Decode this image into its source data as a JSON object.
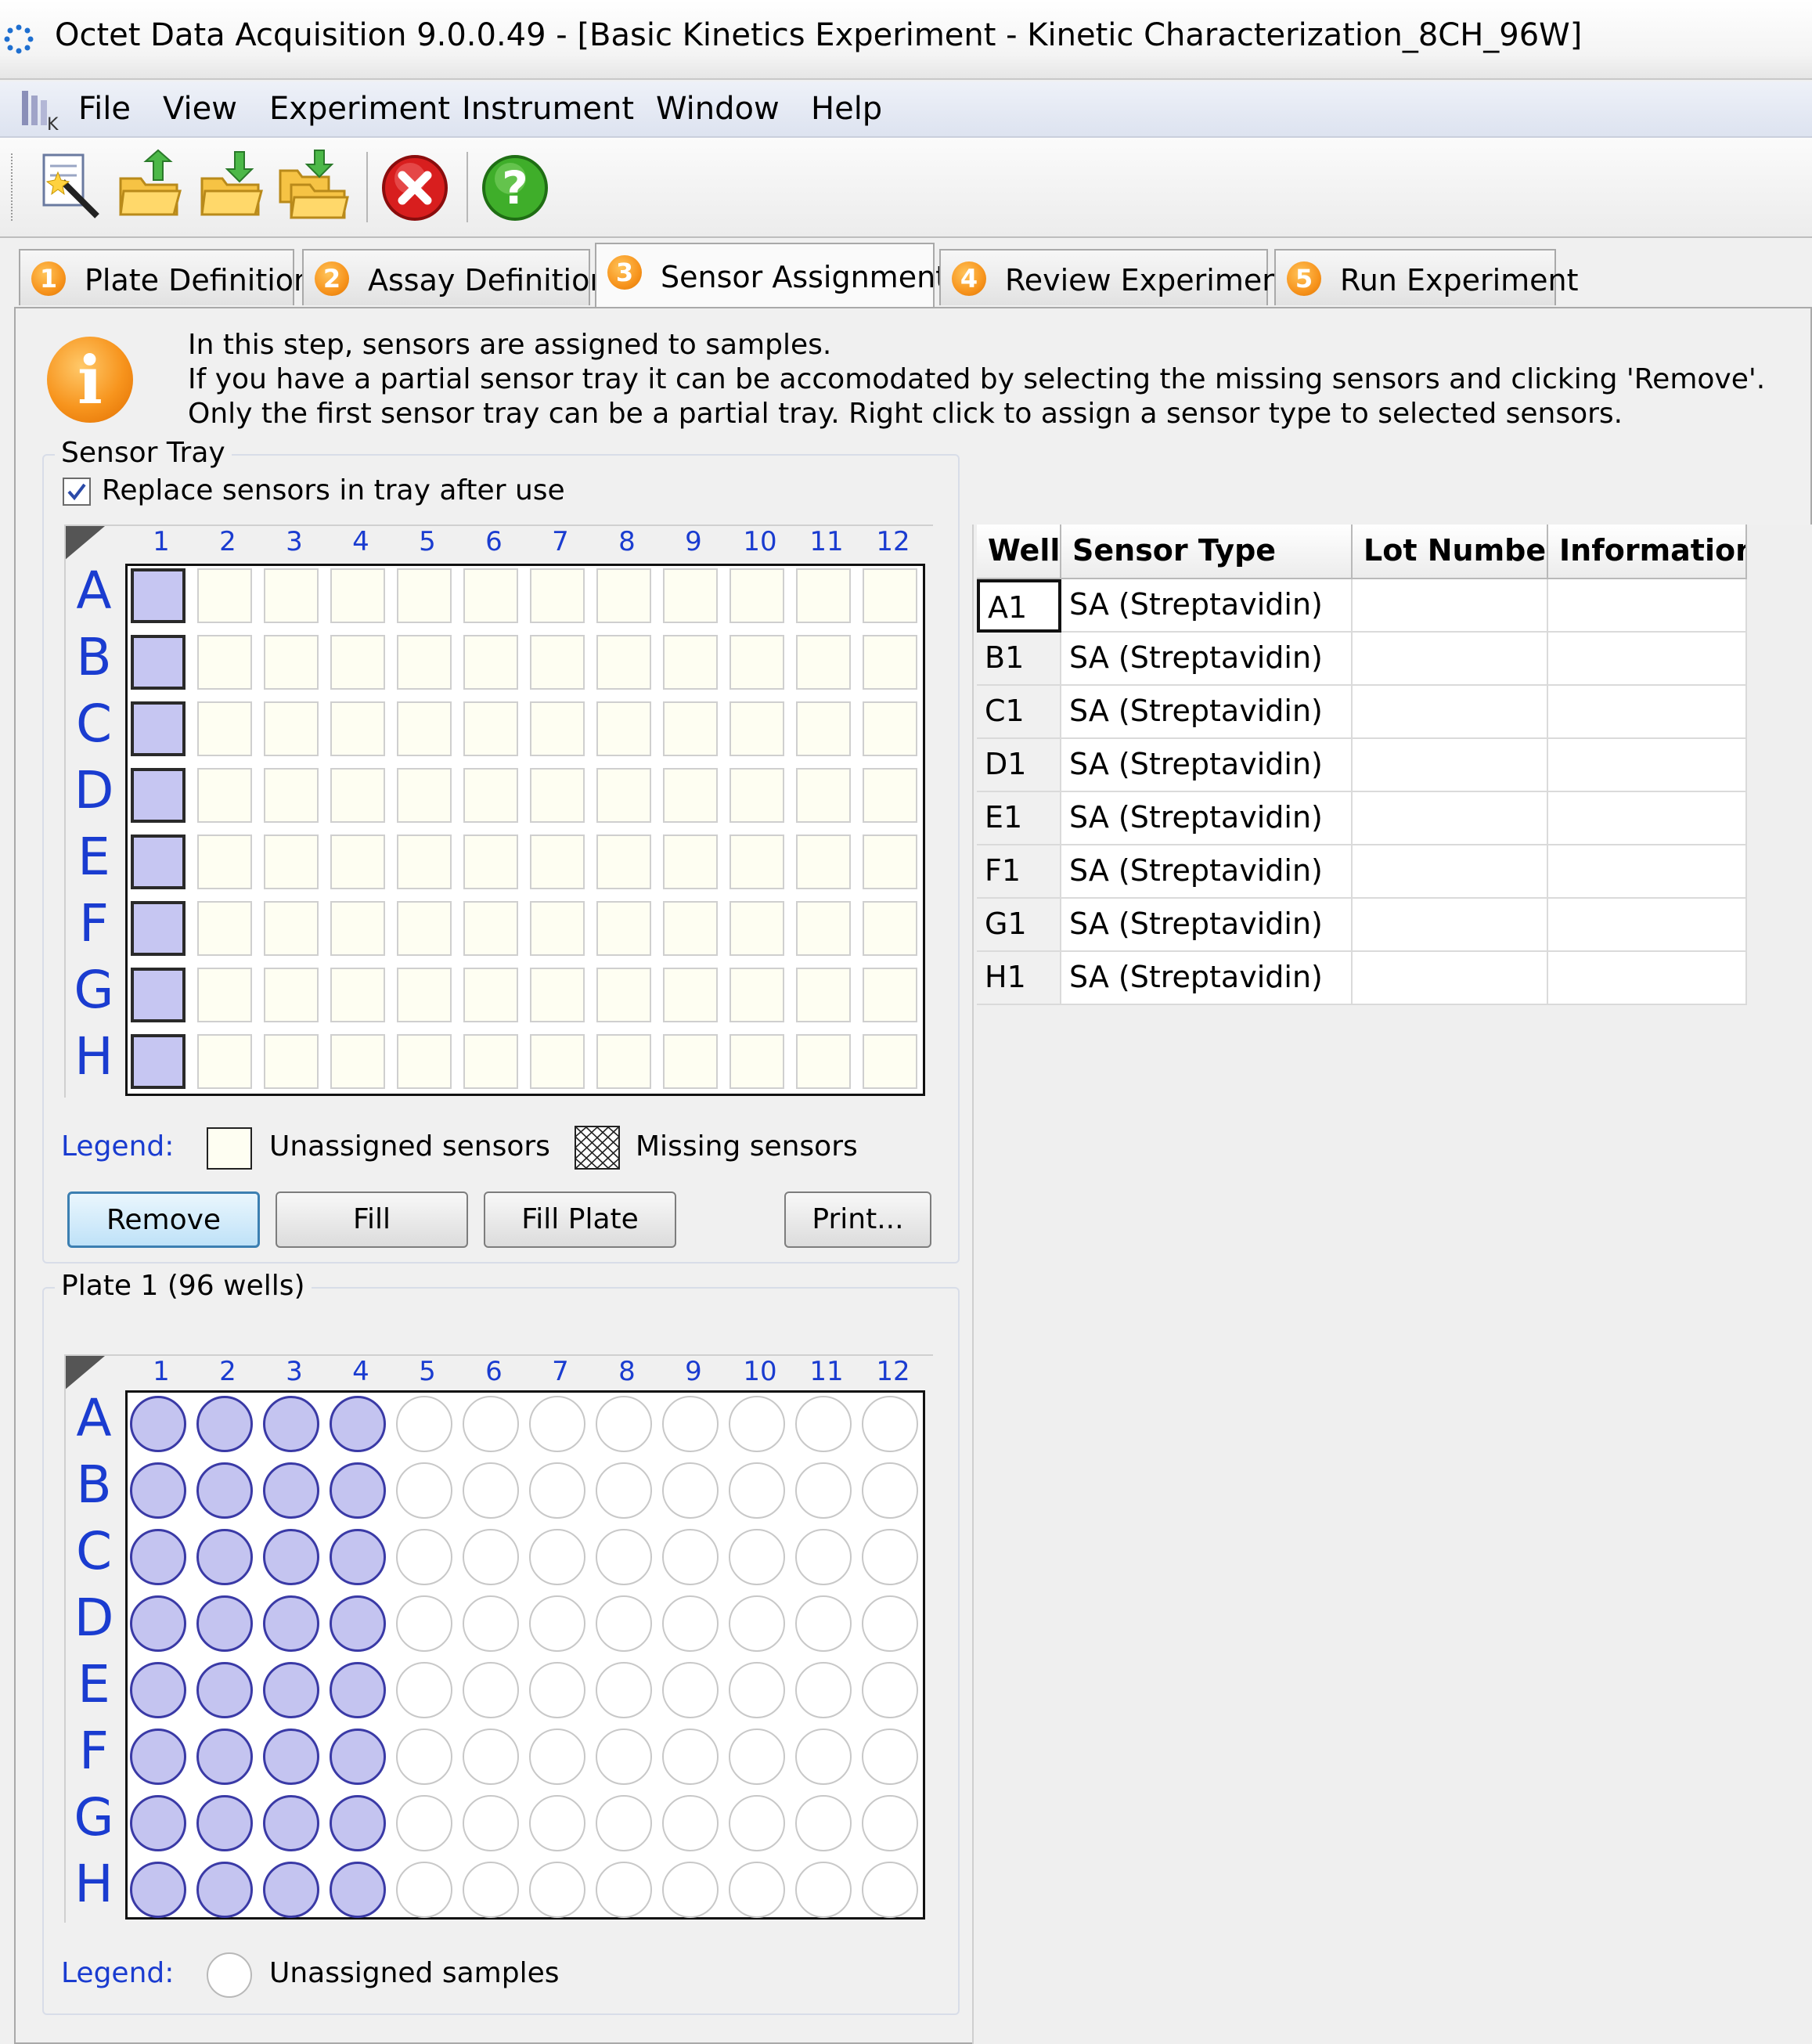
{
  "window": {
    "title": "Octet Data Acquisition 9.0.0.49 - [Basic Kinetics Experiment - Kinetic Characterization_8CH_96W]"
  },
  "menu": [
    "File",
    "View",
    "Experiment",
    "Instrument",
    "Window",
    "Help"
  ],
  "toolbar": {
    "icons": [
      "new-experiment-wizard-icon",
      "open-folder-icon",
      "save-folder-icon",
      "save-all-folder-icon",
      "stop-icon",
      "help-icon"
    ]
  },
  "tabs": [
    {
      "num": "1",
      "label": "Plate Definition"
    },
    {
      "num": "2",
      "label": "Assay Definition"
    },
    {
      "num": "3",
      "label": "Sensor Assignment"
    },
    {
      "num": "4",
      "label": "Review Experiment"
    },
    {
      "num": "5",
      "label": "Run Experiment"
    }
  ],
  "active_tab": "Sensor Assignment",
  "info": {
    "line1": "In this step, sensors are assigned to samples.",
    "line2": "If you have a partial sensor tray it can be accomodated by selecting the missing sensors and clicking 'Remove'.",
    "line3": "Only the first sensor tray can be a partial tray.   Right click to assign a sensor type to selected sensors."
  },
  "sensor_tray": {
    "title": "Sensor Tray",
    "replace_label": "Replace sensors in tray after use",
    "replace_checked": true,
    "columns": [
      "1",
      "2",
      "3",
      "4",
      "5",
      "6",
      "7",
      "8",
      "9",
      "10",
      "11",
      "12"
    ],
    "rows": [
      "A",
      "B",
      "C",
      "D",
      "E",
      "F",
      "G",
      "H"
    ],
    "assigned_columns": [
      "1"
    ],
    "legend_label": "Legend:",
    "legend_unassigned": "Unassigned sensors",
    "legend_missing": "Missing sensors",
    "buttons": {
      "remove": "Remove",
      "fill": "Fill",
      "fill_plate": "Fill Plate",
      "print": "Print..."
    }
  },
  "plate": {
    "title": "Plate 1 (96 wells)",
    "columns": [
      "1",
      "2",
      "3",
      "4",
      "5",
      "6",
      "7",
      "8",
      "9",
      "10",
      "11",
      "12"
    ],
    "rows": [
      "A",
      "B",
      "C",
      "D",
      "E",
      "F",
      "G",
      "H"
    ],
    "assigned_columns": [
      "1",
      "2",
      "3",
      "4"
    ],
    "legend_label": "Legend:",
    "legend_unassigned": "Unassigned samples"
  },
  "table": {
    "headers": {
      "well": "Well",
      "sensor_type": "Sensor Type",
      "lot_number": "Lot Number",
      "information": "Information"
    },
    "rows": [
      {
        "well": "A1",
        "sensor_type": "SA (Streptavidin)",
        "lot_number": "",
        "information": ""
      },
      {
        "well": "B1",
        "sensor_type": "SA (Streptavidin)",
        "lot_number": "",
        "information": ""
      },
      {
        "well": "C1",
        "sensor_type": "SA (Streptavidin)",
        "lot_number": "",
        "information": ""
      },
      {
        "well": "D1",
        "sensor_type": "SA (Streptavidin)",
        "lot_number": "",
        "information": ""
      },
      {
        "well": "E1",
        "sensor_type": "SA (Streptavidin)",
        "lot_number": "",
        "information": ""
      },
      {
        "well": "F1",
        "sensor_type": "SA (Streptavidin)",
        "lot_number": "",
        "information": ""
      },
      {
        "well": "G1",
        "sensor_type": "SA (Streptavidin)",
        "lot_number": "",
        "information": ""
      },
      {
        "well": "H1",
        "sensor_type": "SA (Streptavidin)",
        "lot_number": "",
        "information": ""
      }
    ],
    "selected_row": "A1"
  },
  "colors": {
    "accent_blue": "#1a3cd0",
    "assigned_fill": "#c6c6f2",
    "unassigned_fill": "#fefef2",
    "tab_badge": "#f7941d"
  }
}
